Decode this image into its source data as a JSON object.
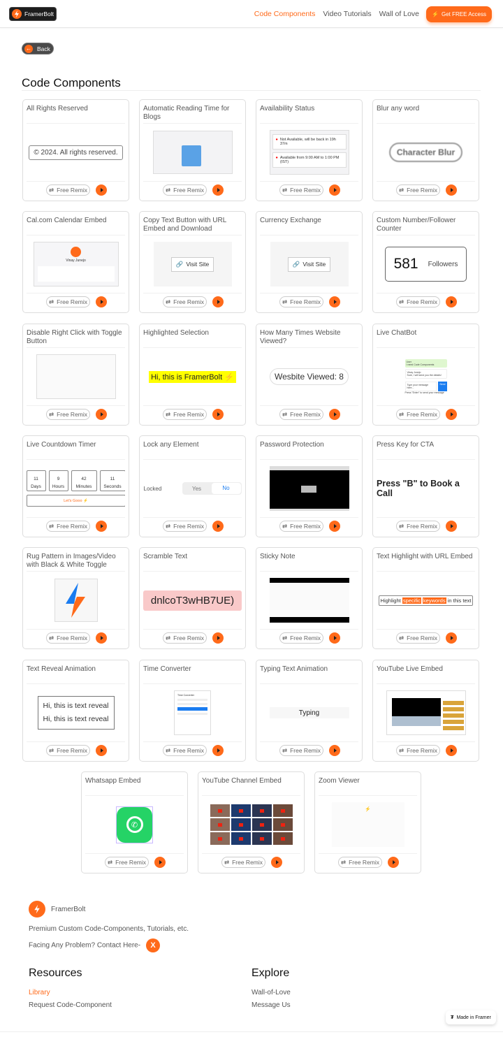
{
  "nav": {
    "brand": "FramerBolt",
    "links": [
      {
        "label": "Code Components",
        "active": true
      },
      {
        "label": "Video Tutorials",
        "active": false
      },
      {
        "label": "Wall of Love",
        "active": false
      }
    ],
    "cta_label": "Get FREE Access"
  },
  "back_label": "Back",
  "page_title": "Code Components",
  "remix_label": "Free Remix",
  "cards": [
    {
      "title": "All Rights Reserved",
      "preview_text": "© 2024. All rights reserved."
    },
    {
      "title": "Automatic Reading Time for Blogs"
    },
    {
      "title": "Availability Status",
      "status_lines": [
        "Not Available, will be back in 19h 37m",
        "Available from 9:00 AM to 1:00 PM (IST)"
      ]
    },
    {
      "title": "Blur any word",
      "preview_text": "Character Blur"
    },
    {
      "title": "Cal.com Calendar Embed",
      "preview_text": "Vinay Junejo"
    },
    {
      "title": "Copy Text Button with URL Embed and Download",
      "preview_text": "Visit Site"
    },
    {
      "title": "Currency Exchange",
      "preview_text": "Visit Site"
    },
    {
      "title": "Custom Number/Follower Counter",
      "count": "581",
      "count_label": "Followers"
    },
    {
      "title": "Disable Right Click with Toggle Button"
    },
    {
      "title": "Highlighted Selection",
      "preview_text": "Hi, this is FramerBolt"
    },
    {
      "title": "How Many Times Website Viewed?",
      "preview_text": "Wesbite Viewed: 8"
    },
    {
      "title": "Live ChatBot",
      "chat": {
        "user_name": "User",
        "user_msg": "I need Code Components",
        "bot_name": "Vinay Junejo",
        "bot_msg": "Sure, I will send you the details!",
        "input_placeholder": "Type your message here...",
        "send": "Send",
        "hint": "Press \"Enter\" to send your message"
      }
    },
    {
      "title": "Live Countdown Timer",
      "timer": [
        {
          "v": "11",
          "u": "Days"
        },
        {
          "v": "9",
          "u": "Hours"
        },
        {
          "v": "42",
          "u": "Minutes"
        },
        {
          "v": "11",
          "u": "Seconds"
        }
      ],
      "button": "Let's Gooo"
    },
    {
      "title": "Lock any Element",
      "lock_label": "Locked",
      "yes": "Yes",
      "no": "No"
    },
    {
      "title": "Password Protection"
    },
    {
      "title": "Press Key for CTA",
      "preview_text": "Press \"B\" to Book a Call"
    },
    {
      "title": "Rug Pattern in Images/Video with Black & White Toggle"
    },
    {
      "title": "Scramble Text",
      "preview_text": "dnlcoT3wHB7UE)"
    },
    {
      "title": "Sticky Note"
    },
    {
      "title": "Text Highlight with URL Embed",
      "parts": [
        "Highlight",
        "specific",
        "keywords",
        "in this text"
      ]
    },
    {
      "title": "Text Reveal Animation",
      "preview_text": "Hi, this is text reveal"
    },
    {
      "title": "Time Converter",
      "preview_text": "Time Converter"
    },
    {
      "title": "Typing Text Animation",
      "preview_text": "Typing"
    },
    {
      "title": "YouTube Live Embed"
    },
    {
      "title": "Whatsapp Embed"
    },
    {
      "title": "YouTube Channel Embed"
    },
    {
      "title": "Zoom Viewer"
    }
  ],
  "footer": {
    "brand": "FramerBolt",
    "tagline": "Premium Custom Code-Components, Tutorials, etc.",
    "contact": "Facing Any Problem? Contact Here-",
    "resources_title": "Resources",
    "resources": [
      "Library",
      "Request Code-Component"
    ],
    "explore_title": "Explore",
    "explore": [
      "Wall-of-Love",
      "Message Us"
    ],
    "made_in": "Made in Framer"
  },
  "colors": {
    "accent": "#ff6a1a",
    "highlight_yellow": "#ffff00",
    "scramble_bg": "#f9c9c9",
    "whatsapp": "#25d366"
  }
}
